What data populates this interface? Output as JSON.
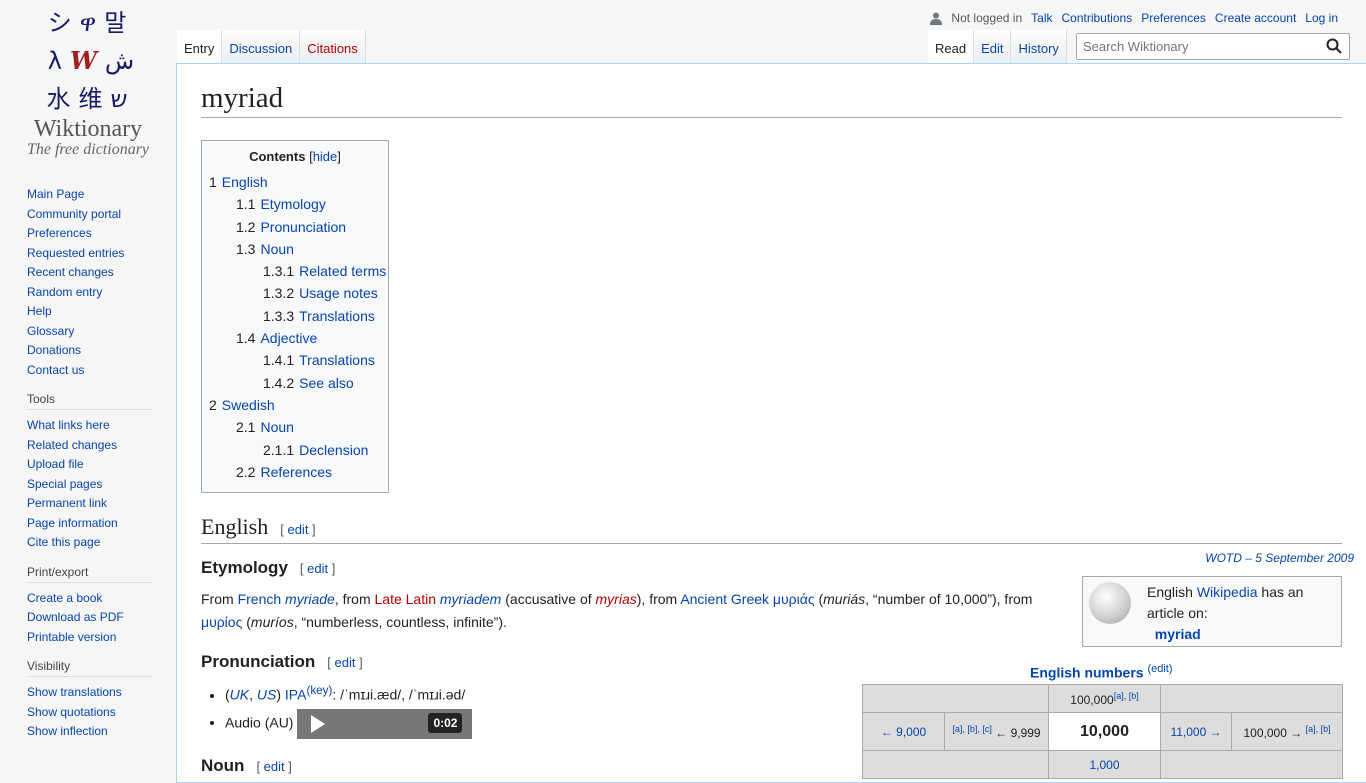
{
  "logo": {
    "name": "Wiktionary",
    "tagline": "The free dictionary",
    "glyphs": [
      "シ",
      "ዋ",
      "말",
      "λ",
      "W",
      "ش",
      "水",
      "维",
      "ש"
    ]
  },
  "sidebar": {
    "nav": [
      "Main Page",
      "Community portal",
      "Preferences",
      "Requested entries",
      "Recent changes",
      "Random entry",
      "Help",
      "Glossary",
      "Donations",
      "Contact us"
    ],
    "tools": {
      "title": "Tools",
      "items": [
        "What links here",
        "Related changes",
        "Upload file",
        "Special pages",
        "Permanent link",
        "Page information",
        "Cite this page"
      ]
    },
    "print": {
      "title": "Print/export",
      "items": [
        "Create a book",
        "Download as PDF",
        "Printable version"
      ]
    },
    "visibility": {
      "title": "Visibility",
      "items": [
        "Show translations",
        "Show quotations",
        "Show inflection"
      ]
    }
  },
  "personal": {
    "status": "Not logged in",
    "links": [
      "Talk",
      "Contributions",
      "Preferences",
      "Create account",
      "Log in"
    ]
  },
  "tabs": {
    "left": [
      "Entry",
      "Discussion",
      "Citations"
    ],
    "right": [
      "Read",
      "Edit",
      "History"
    ]
  },
  "search": {
    "placeholder": "Search Wiktionary"
  },
  "page": {
    "title": "myriad"
  },
  "toc": {
    "title": "Contents",
    "hide": "hide",
    "items": [
      {
        "n": "1",
        "t": "English",
        "l": 0
      },
      {
        "n": "1.1",
        "t": "Etymology",
        "l": 1
      },
      {
        "n": "1.2",
        "t": "Pronunciation",
        "l": 1
      },
      {
        "n": "1.3",
        "t": "Noun",
        "l": 1
      },
      {
        "n": "1.3.1",
        "t": "Related terms",
        "l": 2
      },
      {
        "n": "1.3.2",
        "t": "Usage notes",
        "l": 2
      },
      {
        "n": "1.3.3",
        "t": "Translations",
        "l": 2
      },
      {
        "n": "1.4",
        "t": "Adjective",
        "l": 1
      },
      {
        "n": "1.4.1",
        "t": "Translations",
        "l": 2
      },
      {
        "n": "1.4.2",
        "t": "See also",
        "l": 2
      },
      {
        "n": "2",
        "t": "Swedish",
        "l": 0
      },
      {
        "n": "2.1",
        "t": "Noun",
        "l": 1
      },
      {
        "n": "2.1.1",
        "t": "Declension",
        "l": 2
      },
      {
        "n": "2.2",
        "t": "References",
        "l": 1
      }
    ]
  },
  "english": {
    "heading": "English",
    "edit": "edit",
    "wotd": "WOTD – 5 September 2009",
    "etymology": {
      "heading": "Etymology",
      "edit": "edit",
      "parts": [
        "From ",
        "French",
        " ",
        "myriade",
        ", from ",
        "Late Latin",
        " ",
        "myriadem",
        " (accusative of ",
        "myrias",
        "), from ",
        "Ancient Greek",
        " ",
        "μυριάς",
        " (",
        "muriás",
        ", “number of 10,000”), from ",
        "μυρίος",
        " (",
        "muríos",
        ", “numberless, countless, infinite”)."
      ]
    },
    "pronunciation": {
      "heading": "Pronunciation",
      "edit": "edit",
      "ipa_pre": "(",
      "uk": "UK",
      "sep": ", ",
      "us": "US",
      "ipa_close": ") ",
      "ipa": "IPA",
      "key": "(key)",
      "ipa_value": ": /ˈmɪɹi.æd/, /ˈmɪɹi.əd/",
      "audio": "Audio (AU)",
      "audio_time": "0:02"
    },
    "noun": {
      "heading": "Noun",
      "edit": "edit"
    }
  },
  "wikipedia": {
    "pre": "English ",
    "link": "Wikipedia",
    "post": " has an article on:",
    "article": "myriad"
  },
  "numbers": {
    "title": "English numbers",
    "edit": "(edit)",
    "top": "100,000",
    "top_refs": "[a], [b]",
    "prev2": "← 9,000",
    "prev1_refs": "[a], [b], [c]",
    "prev1": "← 9,999",
    "current": "10,000",
    "next1": "11,000 →",
    "next2": "100,000 →",
    "next2_refs": "[a], [b]",
    "bottom": "1,000"
  }
}
